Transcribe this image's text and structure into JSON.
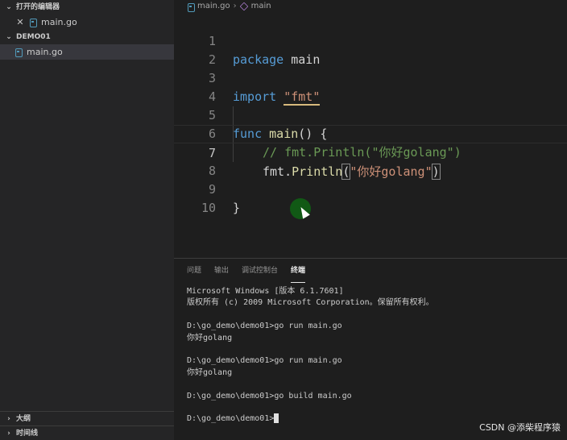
{
  "sidebar": {
    "open_editors_title": "打开的编辑器",
    "open_editors": [
      {
        "name": "main.go"
      }
    ],
    "folder_title": "DEMO01",
    "files": [
      {
        "name": "main.go"
      }
    ],
    "outline_title": "大纲",
    "timeline_title": "时间线"
  },
  "editor": {
    "breadcrumb": {
      "file": "main.go",
      "symbol": "main"
    },
    "line_numbers": [
      "1",
      "2",
      "3",
      "4",
      "5",
      "6",
      "7",
      "8",
      "9",
      "10"
    ],
    "code": {
      "l1_kw": "package",
      "l1_name": "main",
      "l3_kw": "import",
      "l3_str": "\"fmt\"",
      "l5_kw": "func",
      "l5_fn": "main",
      "l5_rest": "() {",
      "l6_comment": "// fmt.Println(\"你好golang\")",
      "l7_pkg": "fmt",
      "l7_dot": ".",
      "l7_fn": "Println",
      "l7_open": "(",
      "l7_str": "\"你好golang\"",
      "l7_close": ")",
      "l9": "}"
    }
  },
  "panel": {
    "tabs": [
      {
        "label": "问题",
        "active": false
      },
      {
        "label": "输出",
        "active": false
      },
      {
        "label": "调试控制台",
        "active": false
      },
      {
        "label": "终端",
        "active": true
      }
    ],
    "terminal_lines": [
      "Microsoft Windows [版本 6.1.7601]",
      "版权所有 (c) 2009 Microsoft Corporation。保留所有权利。",
      "",
      "D:\\go_demo\\demo01>go run main.go",
      "你好golang",
      "",
      "D:\\go_demo\\demo01>go run main.go",
      "你好golang",
      "",
      "D:\\go_demo\\demo01>go build main.go",
      "",
      "D:\\go_demo\\demo01>"
    ]
  },
  "watermark": "CSDN @添柴程序猿",
  "colors": {
    "keyword": "#569cd6",
    "function": "#dcdcaa",
    "string": "#ce9178",
    "comment": "#6a9955",
    "go_icon": "#519aba"
  }
}
